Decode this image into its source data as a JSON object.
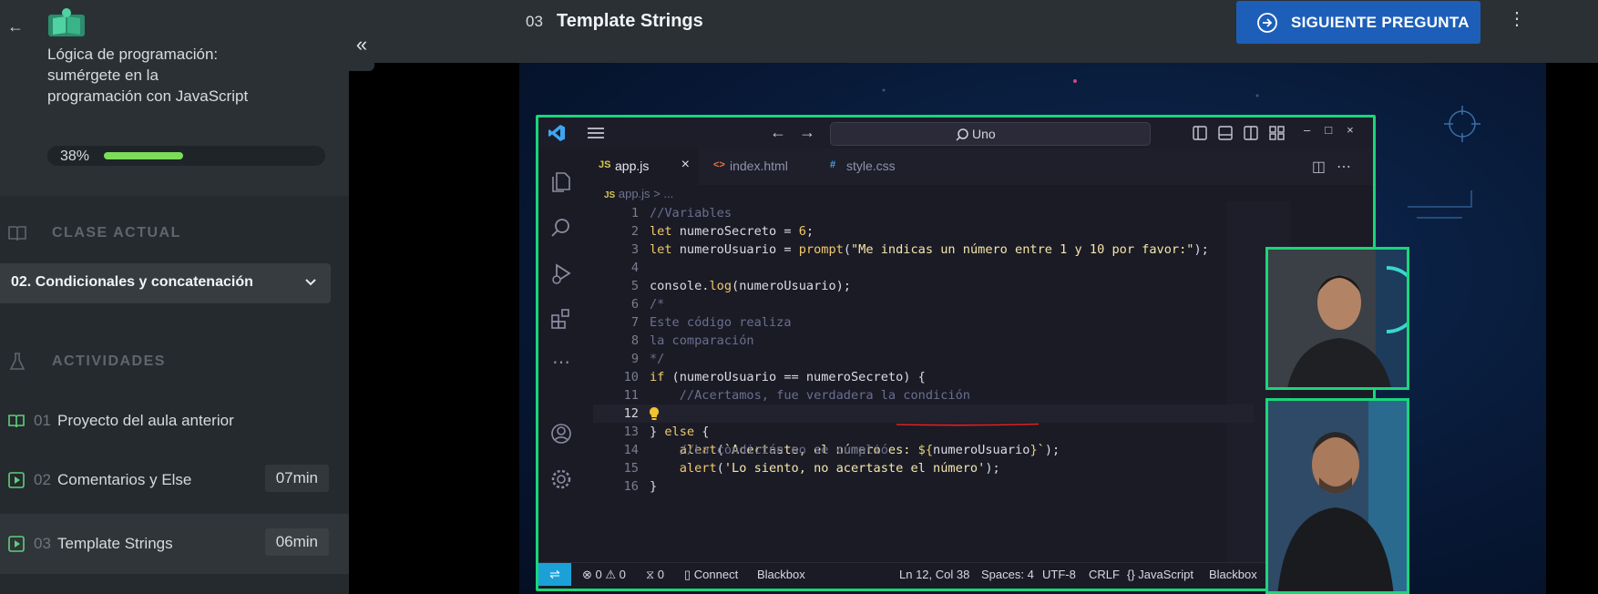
{
  "sidebar": {
    "course_title": "Lógica de programación: sumérgete en la programación con JavaScript",
    "progress_label": "38%",
    "progress_value": 0.38,
    "current_class_label": "CLASE ACTUAL",
    "lesson_select": "02. Condicionales y concatenación",
    "activities_label": "ACTIVIDADES",
    "activities": [
      {
        "num": "01",
        "title": "Proyecto del aula anterior",
        "duration": "",
        "icon": "book-icon"
      },
      {
        "num": "02",
        "title": "Comentarios y Else",
        "duration": "07min",
        "icon": "play-icon"
      },
      {
        "num": "03",
        "title": "Template Strings",
        "duration": "06min",
        "icon": "play-icon"
      }
    ]
  },
  "header": {
    "lesson_num": "03",
    "lesson_title": "Template Strings",
    "next_button": "SIGUIENTE PREGUNTA"
  },
  "editor": {
    "search": "Uno",
    "tabs": [
      {
        "icon": "JS",
        "label": "app.js"
      },
      {
        "icon": "<>",
        "label": "index.html"
      },
      {
        "icon": "#",
        "label": "style.css"
      }
    ],
    "breadcrumb": "app.js",
    "breadcrumb_suffix": "> ...",
    "status": {
      "errors": "0",
      "warnings": "0",
      "ports": "0",
      "connect": "Connect",
      "blackbox_left": "Blackbox",
      "position": "Ln 12, Col 38",
      "spaces": "Spaces: 4",
      "encoding": "UTF-8",
      "eol": "CRLF",
      "language": "JavaScript",
      "blackbox_right": "Blackbox"
    }
  },
  "colors": {
    "accent_green": "#19d67a",
    "progress_green": "#7ddc5a",
    "button_blue": "#1d5fb8"
  }
}
